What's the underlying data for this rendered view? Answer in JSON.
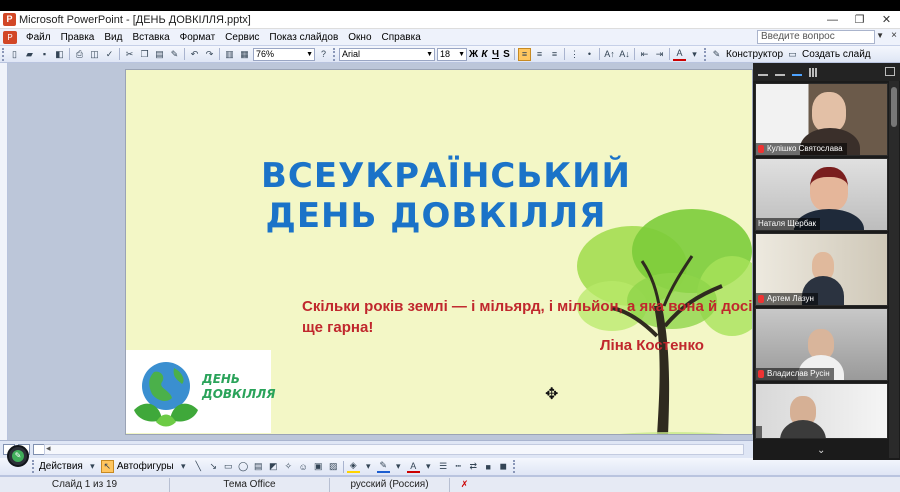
{
  "window": {
    "title": "Microsoft PowerPoint - [ДЕНЬ ДОВКІЛЛЯ.pptx]",
    "minimize": "—",
    "restore": "❐",
    "close": "✕"
  },
  "menu": {
    "items": [
      "Файл",
      "Правка",
      "Вид",
      "Вставка",
      "Формат",
      "Сервис",
      "Показ слайдов",
      "Окно",
      "Справка"
    ],
    "help_placeholder": "Введите вопрос",
    "doc_close": "×"
  },
  "toolbar": {
    "zoom": "76%",
    "font": "Arial",
    "font_size": "18",
    "bold": "Ж",
    "italic": "К",
    "underline": "Ч",
    "shadow": "S",
    "designer_label": "Конструктор",
    "new_slide_label": "Создать слайд"
  },
  "slide": {
    "title_line1": "ВСЕУКРАЇНСЬКИЙ",
    "title_line2": "ДЕНЬ ДОВКІЛЛЯ",
    "quote": "Скільки років землі — і мільярд, і мільйон, а яка вона й досі ще гарна!",
    "author": "Ліна Костенко",
    "logo_line1": "ДЕНЬ",
    "logo_line2": "ДОВКІЛЛЯ",
    "colors": {
      "background": "#f3f7c6",
      "title": "#1b73c8",
      "quote": "#c0272d"
    }
  },
  "drawing_toolbar": {
    "actions_label": "Действия",
    "autoshapes_label": "Автофигуры"
  },
  "status": {
    "slide_counter": "Слайд 1 из 19",
    "theme": "Тема Office",
    "language": "русский (Россия)"
  },
  "video_panel": {
    "participants": [
      {
        "name": "Кулішко Святослава"
      },
      {
        "name": "Наталя Щербак"
      },
      {
        "name": "Артем Лазун"
      },
      {
        "name": "Владислав Русін"
      },
      {
        "name": ""
      }
    ],
    "more": "⌄"
  }
}
